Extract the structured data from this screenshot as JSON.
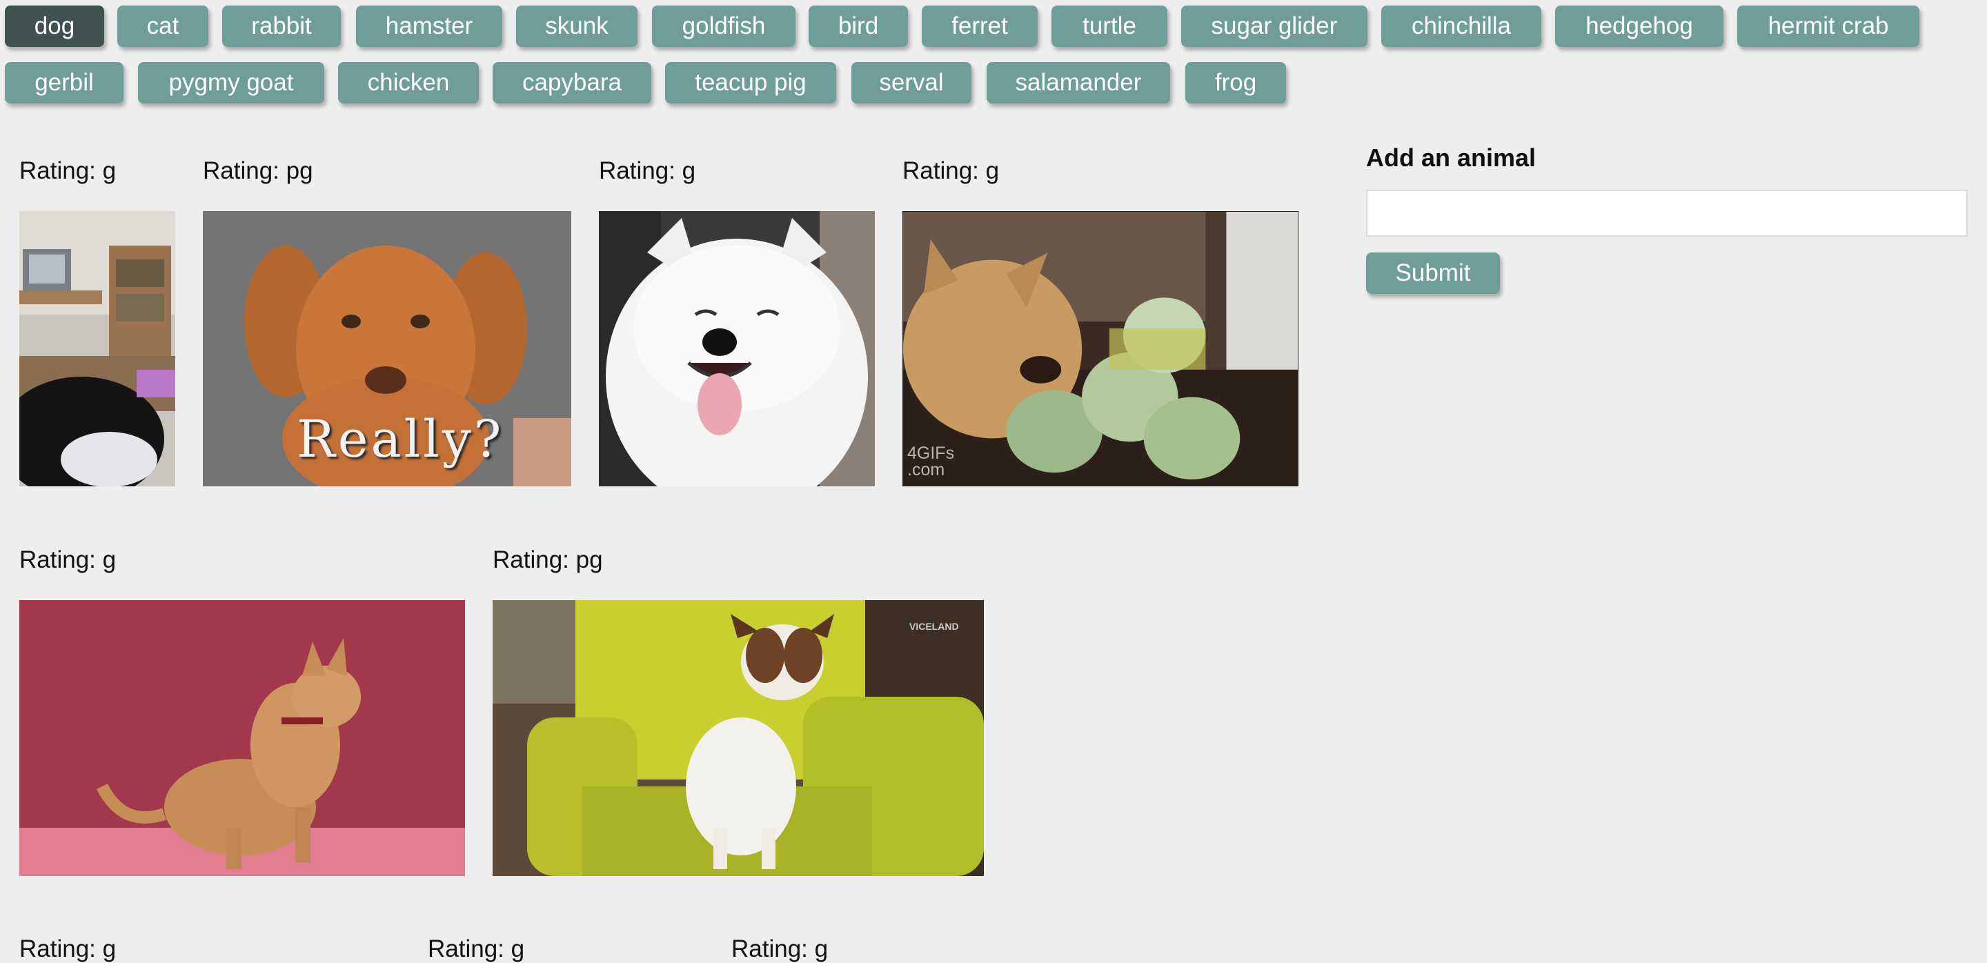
{
  "animals": [
    "dog",
    "cat",
    "rabbit",
    "hamster",
    "skunk",
    "goldfish",
    "bird",
    "ferret",
    "turtle",
    "sugar glider",
    "chinchilla",
    "hedgehog",
    "hermit crab",
    "gerbil",
    "pygmy goat",
    "chicken",
    "capybara",
    "teacup pig",
    "serval",
    "salamander",
    "frog"
  ],
  "active_animal": "dog",
  "gifs": [
    {
      "rating_label": "Rating: g",
      "alt": "cat in room with tv"
    },
    {
      "rating_label": "Rating: pg",
      "alt": "puppy",
      "caption": "Really?"
    },
    {
      "rating_label": "Rating: g",
      "alt": "white fluffy dog smiling"
    },
    {
      "rating_label": "Rating: g",
      "alt": "corgi attacking cabbages",
      "watermark": "4GIFs .com"
    },
    {
      "rating_label": "Rating: g",
      "alt": "tan dog on red background"
    },
    {
      "rating_label": "Rating: pg",
      "alt": "jack russell on green armchair",
      "watermark": "VICELAND"
    },
    {
      "rating_label": "Rating: g"
    },
    {
      "rating_label": "Rating: g"
    },
    {
      "rating_label": "Rating: g"
    }
  ],
  "form": {
    "title": "Add an animal",
    "input_value": "",
    "input_placeholder": "",
    "submit_label": "Submit"
  },
  "colors": {
    "button": "#6f9e99",
    "button_active": "#3f524f",
    "background": "#eeeeee"
  }
}
